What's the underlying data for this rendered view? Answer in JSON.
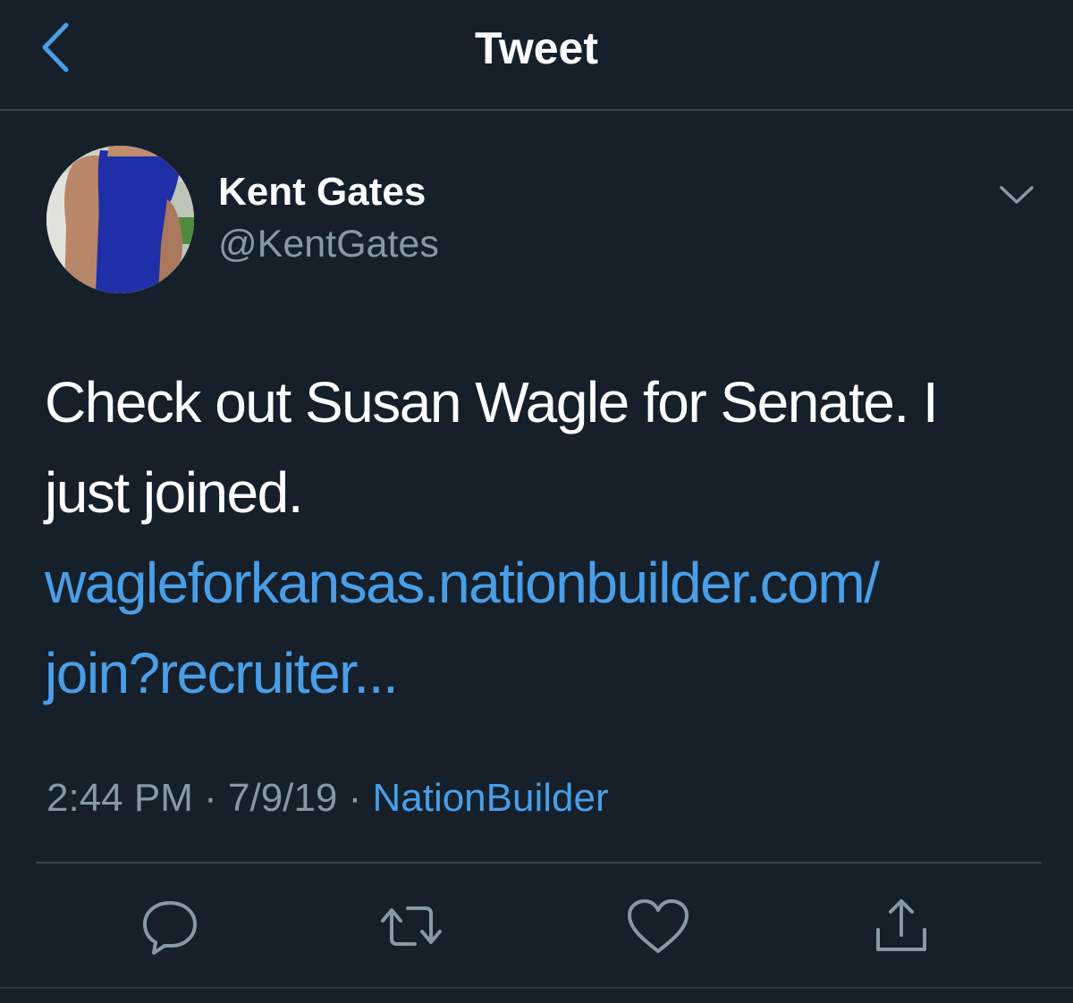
{
  "header": {
    "title": "Tweet",
    "back_icon": "chevron-left-icon"
  },
  "author": {
    "name": "Kent Gates",
    "handle": "@KentGates",
    "menu_icon": "chevron-down-icon"
  },
  "tweet": {
    "text": "Check out Susan Wagle for Senate. I just joined.",
    "link_line1": "wagleforkansas.nationbuilder.com/",
    "link_line2": "join?recruiter..."
  },
  "meta": {
    "time": "2:44 PM",
    "separator": "·",
    "date": "7/9/19",
    "source": "NationBuilder"
  },
  "actions": {
    "reply_icon": "reply-icon",
    "retweet_icon": "retweet-icon",
    "like_icon": "heart-icon",
    "share_icon": "share-icon"
  },
  "colors": {
    "background": "#15202b",
    "accent": "#4a9ee6",
    "secondary_text": "#8899a6",
    "divider": "#38444d"
  }
}
